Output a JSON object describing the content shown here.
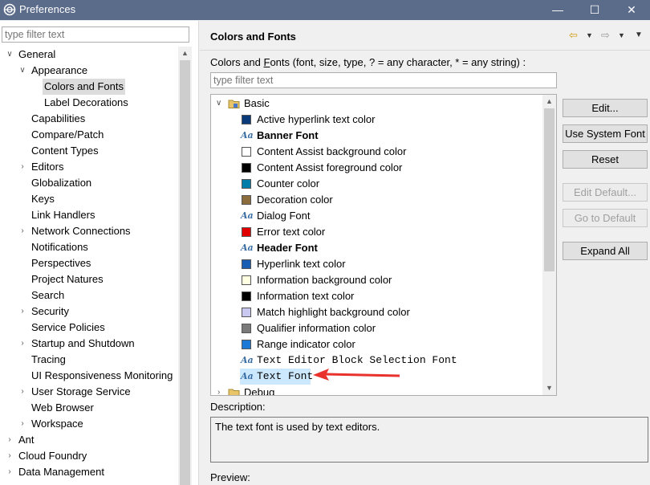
{
  "window": {
    "title": "Preferences",
    "minimize": "—",
    "maximize": "☐",
    "close": "✕"
  },
  "left": {
    "filter_placeholder": "type filter text",
    "tree": [
      {
        "label": "General",
        "indent": 0,
        "twisty": "expanded"
      },
      {
        "label": "Appearance",
        "indent": 1,
        "twisty": "expanded"
      },
      {
        "label": "Colors and Fonts",
        "indent": 2,
        "twisty": "none",
        "selected": true
      },
      {
        "label": "Label Decorations",
        "indent": 2,
        "twisty": "none"
      },
      {
        "label": "Capabilities",
        "indent": 1,
        "twisty": "none"
      },
      {
        "label": "Compare/Patch",
        "indent": 1,
        "twisty": "none"
      },
      {
        "label": "Content Types",
        "indent": 1,
        "twisty": "none"
      },
      {
        "label": "Editors",
        "indent": 1,
        "twisty": "collapsed"
      },
      {
        "label": "Globalization",
        "indent": 1,
        "twisty": "none"
      },
      {
        "label": "Keys",
        "indent": 1,
        "twisty": "none"
      },
      {
        "label": "Link Handlers",
        "indent": 1,
        "twisty": "none"
      },
      {
        "label": "Network Connections",
        "indent": 1,
        "twisty": "collapsed"
      },
      {
        "label": "Notifications",
        "indent": 1,
        "twisty": "none"
      },
      {
        "label": "Perspectives",
        "indent": 1,
        "twisty": "none"
      },
      {
        "label": "Project Natures",
        "indent": 1,
        "twisty": "none"
      },
      {
        "label": "Search",
        "indent": 1,
        "twisty": "none"
      },
      {
        "label": "Security",
        "indent": 1,
        "twisty": "collapsed"
      },
      {
        "label": "Service Policies",
        "indent": 1,
        "twisty": "none"
      },
      {
        "label": "Startup and Shutdown",
        "indent": 1,
        "twisty": "collapsed"
      },
      {
        "label": "Tracing",
        "indent": 1,
        "twisty": "none"
      },
      {
        "label": "UI Responsiveness Monitoring",
        "indent": 1,
        "twisty": "none"
      },
      {
        "label": "User Storage Service",
        "indent": 1,
        "twisty": "collapsed"
      },
      {
        "label": "Web Browser",
        "indent": 1,
        "twisty": "none"
      },
      {
        "label": "Workspace",
        "indent": 1,
        "twisty": "collapsed"
      },
      {
        "label": "Ant",
        "indent": 0,
        "twisty": "collapsed"
      },
      {
        "label": "Cloud Foundry",
        "indent": 0,
        "twisty": "collapsed"
      },
      {
        "label": "Data Management",
        "indent": 0,
        "twisty": "collapsed"
      }
    ]
  },
  "page": {
    "title": "Colors and Fonts",
    "colors_fonts_label_pre": "Colors and ",
    "colors_fonts_label_mnemonic": "F",
    "colors_fonts_label_post": "onts (font, size, type, ? = any character, * = any string) :",
    "filter_placeholder": "type filter text",
    "category_basic": "Basic",
    "category_debug": "Debug",
    "items": [
      {
        "kind": "color",
        "label": "Active hyperlink text color",
        "color": "#0b3a7a"
      },
      {
        "kind": "font",
        "label": "Banner Font",
        "style": "bold"
      },
      {
        "kind": "color",
        "label": "Content Assist background color",
        "color": "#ffffff"
      },
      {
        "kind": "color",
        "label": "Content Assist foreground color",
        "color": "#000000"
      },
      {
        "kind": "color",
        "label": "Counter color",
        "color": "#007da8"
      },
      {
        "kind": "color",
        "label": "Decoration color",
        "color": "#8c6b3c"
      },
      {
        "kind": "font",
        "label": "Dialog Font",
        "style": "normal"
      },
      {
        "kind": "color",
        "label": "Error text color",
        "color": "#e00000"
      },
      {
        "kind": "font",
        "label": "Header Font",
        "style": "bold"
      },
      {
        "kind": "color",
        "label": "Hyperlink text color",
        "color": "#1a5fb4"
      },
      {
        "kind": "color",
        "label": "Information background color",
        "color": "#ffffe1"
      },
      {
        "kind": "color",
        "label": "Information text color",
        "color": "#000000"
      },
      {
        "kind": "color",
        "label": "Match highlight background color",
        "color": "#c8c8f0"
      },
      {
        "kind": "color",
        "label": "Qualifier information color",
        "color": "#7a7a7a"
      },
      {
        "kind": "color",
        "label": "Range indicator color",
        "color": "#1c7ad6"
      },
      {
        "kind": "font",
        "label": "Text Editor Block Selection Font",
        "style": "mono"
      },
      {
        "kind": "font",
        "label": "Text Font",
        "style": "mono",
        "selected": true
      }
    ],
    "buttons": {
      "edit": "Edit...",
      "use_system_font": "Use System Font",
      "reset": "Reset",
      "edit_default": "Edit Default...",
      "go_to_default": "Go to Default",
      "expand_all": "Expand All"
    },
    "description_label": "Description:",
    "description_text": "The text font is used by text editors.",
    "preview_label": "Preview:"
  },
  "colors": {
    "annotation_arrow": "#e8322b",
    "selection": "#cce8ff",
    "titlebar": "#5b6b8a"
  }
}
